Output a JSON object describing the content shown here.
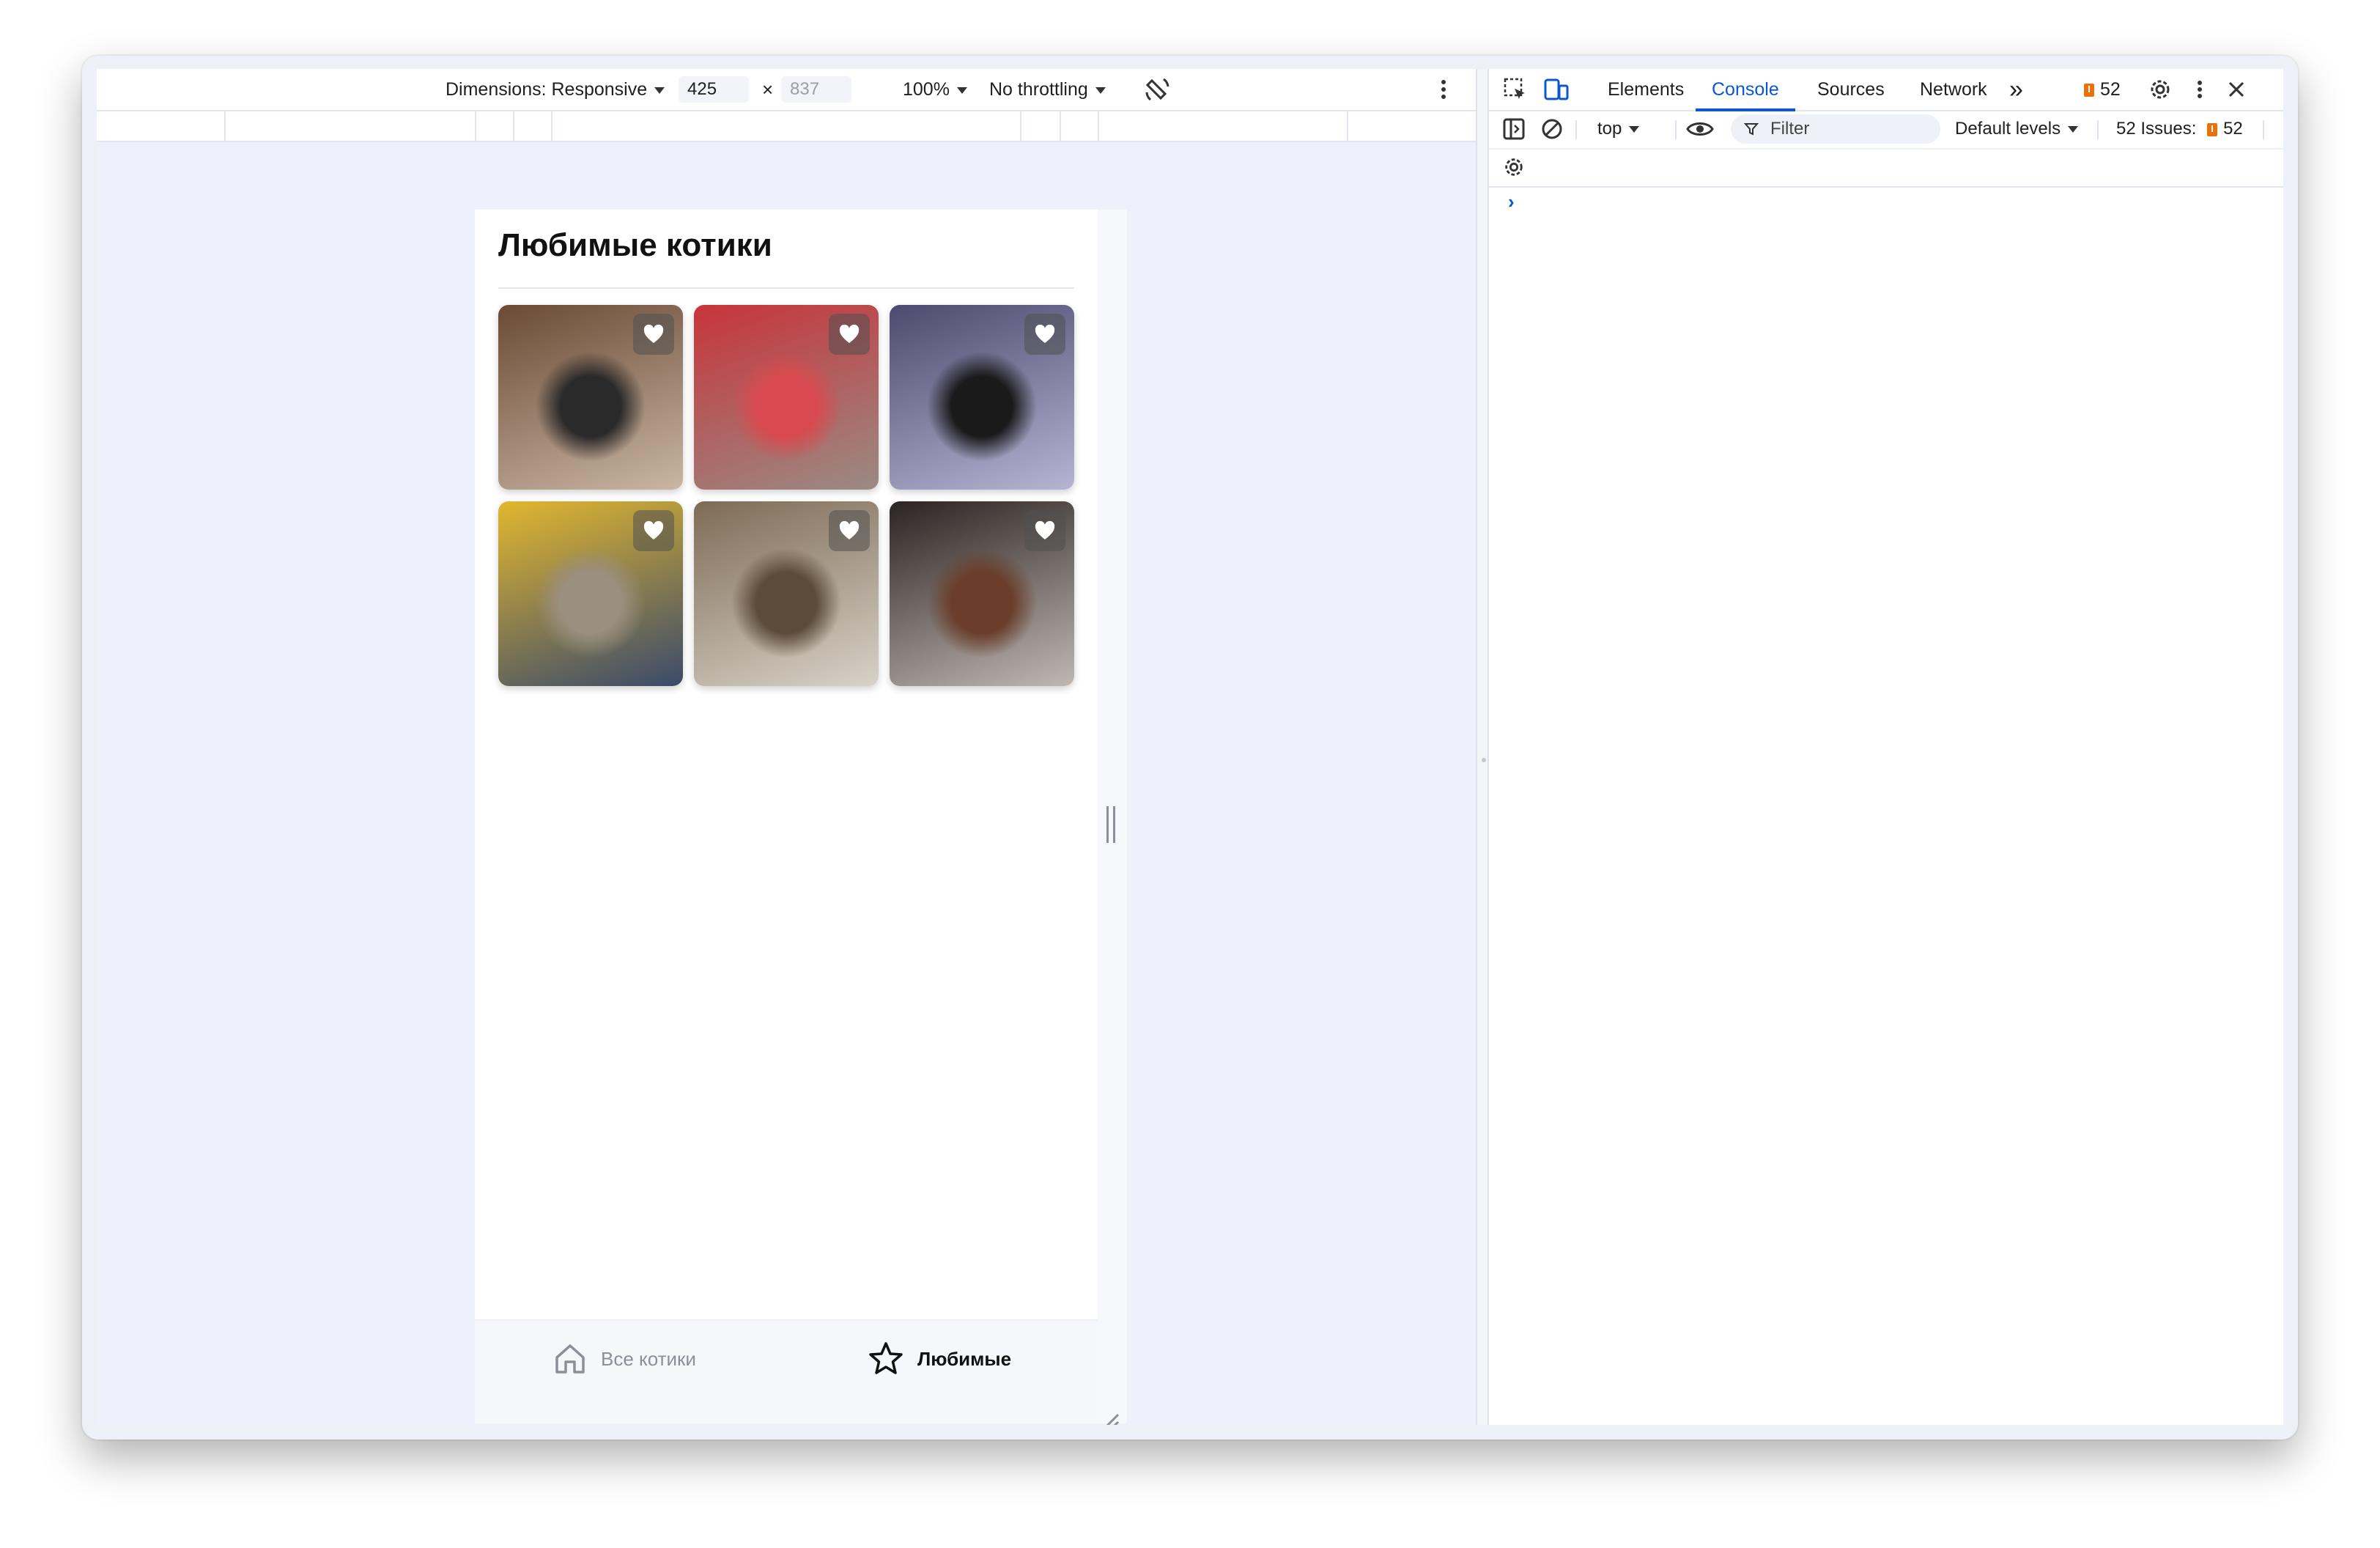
{
  "device_toolbar": {
    "dimensions_label": "Dimensions: Responsive",
    "width": "425",
    "times": "×",
    "height": "837",
    "zoom": "100%",
    "throttling": "No throttling"
  },
  "app": {
    "title": "Любимые котики",
    "cats": [
      {
        "id": "cat-1",
        "colors": [
          "#6b4a35",
          "#c9b6a3",
          "#2a2a2a"
        ]
      },
      {
        "id": "cat-2",
        "colors": [
          "#c7343a",
          "#9a8b84",
          "#d84a4f"
        ]
      },
      {
        "id": "cat-3",
        "colors": [
          "#4c4a6e",
          "#b7b3d3",
          "#1a1a1a"
        ]
      },
      {
        "id": "cat-4",
        "colors": [
          "#e2b72f",
          "#3a4a6a",
          "#9b8f80"
        ]
      },
      {
        "id": "cat-5",
        "colors": [
          "#7e6b55",
          "#d8d2c8",
          "#5b4b3b"
        ]
      },
      {
        "id": "cat-6",
        "colors": [
          "#2b2422",
          "#bfb8b2",
          "#6b3d2a"
        ]
      }
    ],
    "tabs": {
      "all": "Все котики",
      "favorites": "Любимые"
    }
  },
  "devtools": {
    "tabs": [
      "Elements",
      "Console",
      "Sources",
      "Network"
    ],
    "active_tab": "Console",
    "more_tabs": "»",
    "issues_count": "52",
    "context": "top",
    "filter_placeholder": "Filter",
    "levels": "Default levels",
    "issues_label": "52 Issues:",
    "issues_label_count": "52",
    "console_prompt": "›"
  },
  "colors": {
    "accent": "#0b57d0",
    "issue": "#e8710a",
    "page_bg": "#eef1fb"
  }
}
